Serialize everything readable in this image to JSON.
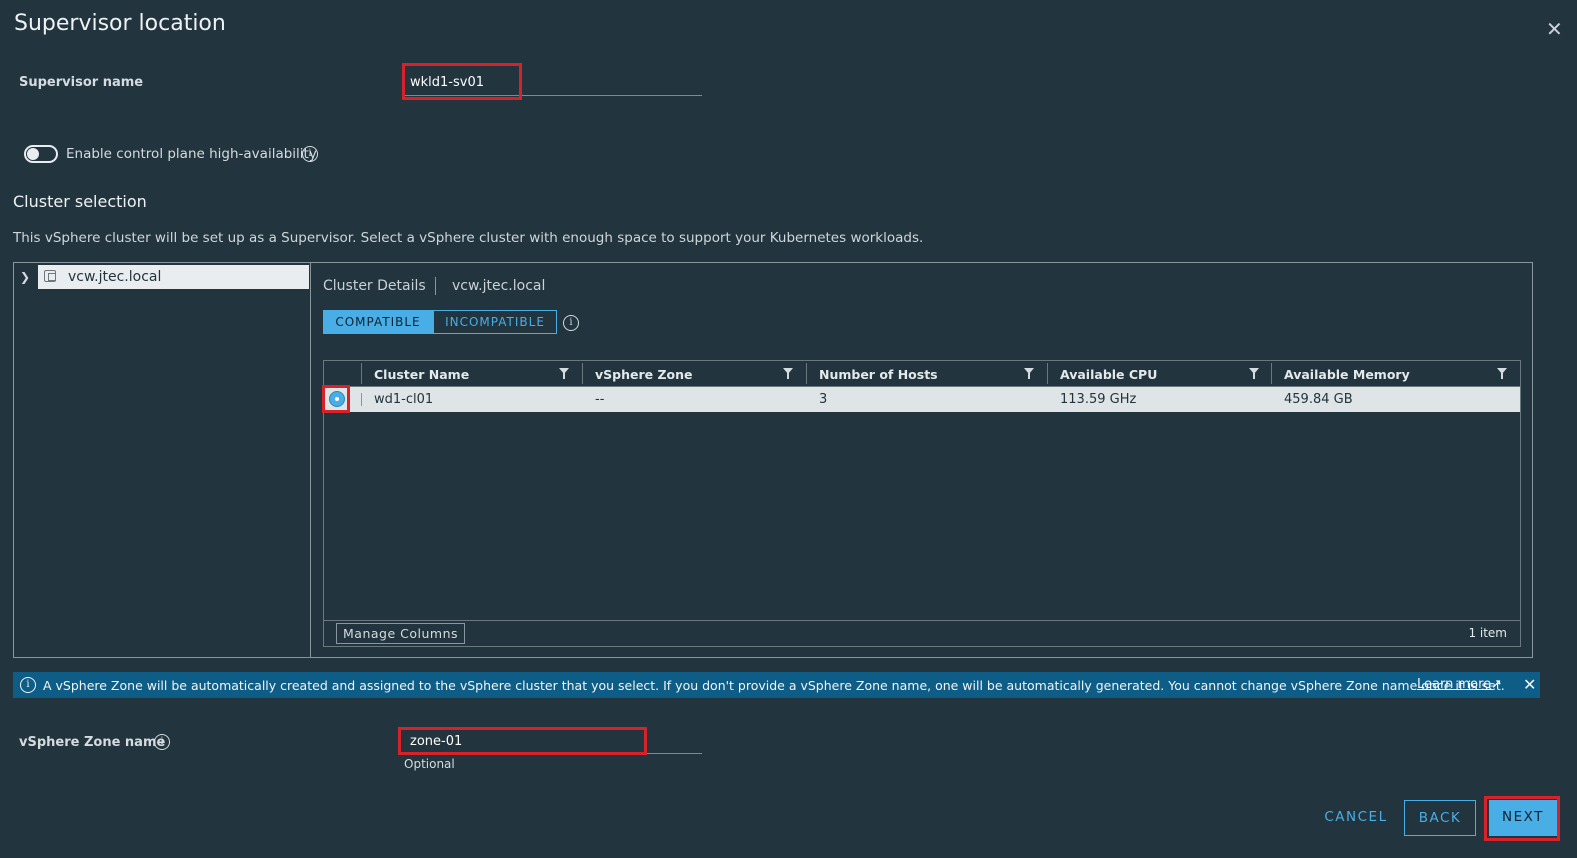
{
  "dialog": {
    "title": "Supervisor location",
    "close_icon": "close-icon"
  },
  "supervisor": {
    "label": "Supervisor name",
    "value": "wkld1-sv01"
  },
  "ha": {
    "label": "Enable control plane high-availability",
    "enabled": false
  },
  "cluster_selection": {
    "heading": "Cluster selection",
    "description": "This vSphere cluster will be set up as a Supervisor. Select a vSphere cluster with enough space to support your Kubernetes workloads.",
    "tree": {
      "node_label": "vcw.jtec.local",
      "node_icon": "vcenter-icon"
    },
    "details": {
      "heading": "Cluster Details",
      "host": "vcw.jtec.local",
      "tabs": {
        "compatible": "COMPATIBLE",
        "incompatible": "INCOMPATIBLE"
      },
      "active_tab": "COMPATIBLE"
    },
    "grid": {
      "columns": [
        "Cluster Name",
        "vSphere Zone",
        "Number of Hosts",
        "Available CPU",
        "Available Memory"
      ],
      "rows": [
        {
          "selected": true,
          "cells": [
            "wd1-cl01",
            "--",
            "3",
            "113.59 GHz",
            "459.84 GB"
          ]
        }
      ],
      "manage_columns": "Manage Columns",
      "item_count": "1 item"
    }
  },
  "banner": {
    "text": "A vSphere Zone will be automatically created and assigned to the vSphere cluster that you select. If you don't provide a vSphere Zone name, one will be automatically generated. You cannot change vSphere Zone name once it is set.",
    "link": "Learn more"
  },
  "zone": {
    "label": "vSphere Zone name",
    "value": "zone-01",
    "helper": "Optional"
  },
  "footer": {
    "cancel": "CANCEL",
    "back": "BACK",
    "next": "NEXT"
  },
  "colors": {
    "background": "#22343e",
    "accent": "#49aee6",
    "banner": "#0d5d87",
    "highlight": "#d8222a"
  }
}
